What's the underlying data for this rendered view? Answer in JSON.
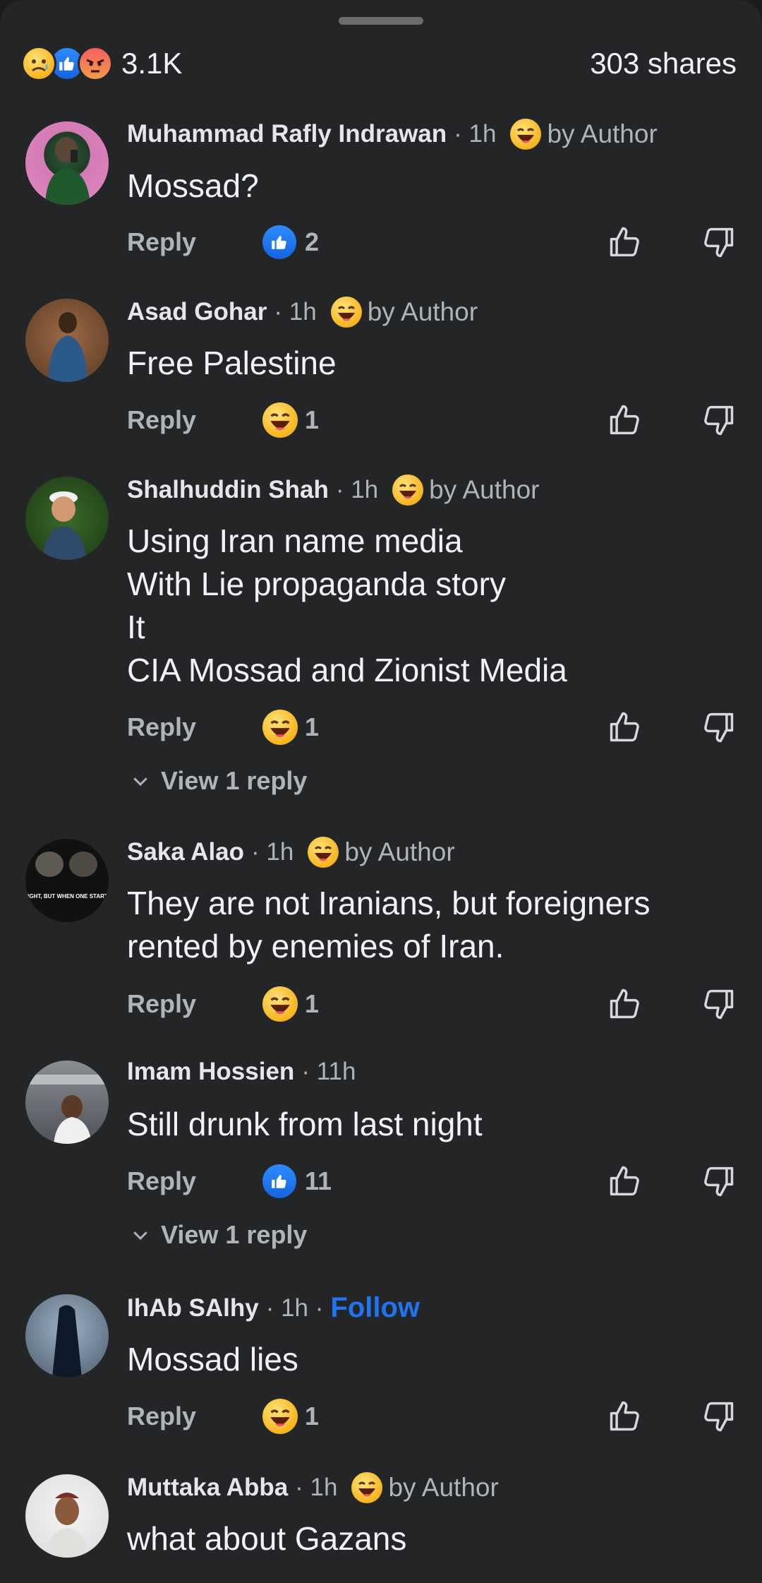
{
  "summary": {
    "reaction_count": "3.1K",
    "shares": "303 shares",
    "reaction_icons": [
      "sad-icon",
      "like-icon",
      "angry-icon"
    ]
  },
  "labels": {
    "reply": "Reply",
    "by_author": "by Author",
    "follow": "Follow",
    "view_reply": "View 1 reply"
  },
  "colors": {
    "background": "#242526",
    "text": "#e4e6eb",
    "muted": "#b0b3b8",
    "follow": "#1f74f0",
    "like": "#1877f2"
  },
  "comments": [
    {
      "name": "Muhammad Rafly Indrawan",
      "time": "· 1h",
      "text": "Mossad?",
      "reaction_icon": "like-icon",
      "reaction_count": "2",
      "by_author": true
    },
    {
      "name": "Asad Gohar",
      "time": "· 1h",
      "text": "Free Palestine",
      "reaction_icon": "haha-icon",
      "reaction_count": "1",
      "by_author": true
    },
    {
      "name": "Shalhuddin Shah",
      "time": "· 1h",
      "text": "Using Iran name media\nWith Lie propaganda story\nIt\nCIA Mossad and Zionist Media",
      "reaction_icon": "haha-icon",
      "reaction_count": "1",
      "by_author": true,
      "view_reply": true
    },
    {
      "name": "Saka Alao",
      "time": "· 1h",
      "text": "They are not Iranians, but foreigners\nrented by enemies of Iran.",
      "reaction_icon": "haha-icon",
      "reaction_count": "1",
      "by_author": true,
      "avatar_text": "WALK A MILE TO AVOID A FIGHT, BUT WHEN ONE STARTS DON'T ...K DOWN AN IN..."
    },
    {
      "name": "Imam Hossien",
      "time": "· 11h",
      "text": "Still drunk from last night",
      "reaction_icon": "like-icon",
      "reaction_count": "11",
      "by_author": false,
      "view_reply": true
    },
    {
      "name": "IhAb SAlhy",
      "time": "· 1h ·",
      "text": "Mossad lies",
      "reaction_icon": "haha-icon",
      "reaction_count": "1",
      "by_author": false,
      "follow": true
    },
    {
      "name": "Muttaka Abba",
      "time": "· 1h",
      "text": "what about Gazans",
      "by_author": true
    }
  ]
}
